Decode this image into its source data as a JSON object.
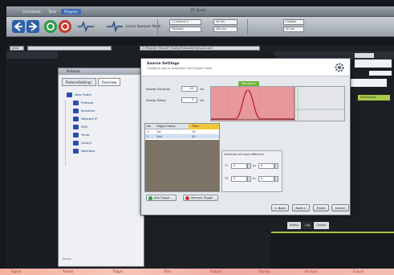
{
  "window": {
    "title": "RF Studio"
  },
  "menubar": {
    "items": [
      "Commands",
      "Tools",
      "Program"
    ]
  },
  "toolbar": {
    "mode_label": "Linear Sweeper Mode",
    "field_1": "1 Channel 1",
    "field_2": "Thermal",
    "field_3": "40 ms",
    "field_4": "200 ms",
    "field_5": "Cardiac",
    "field_6": "40 ms"
  },
  "address": {
    "left_field": "Area",
    "right_field": "C:\\Program Files\\RF Studio\\Protocols\\Protocols.xml"
  },
  "file_window": {
    "title": "Protocol",
    "tabs": [
      "ProtocolSettings",
      "Overview"
    ],
    "tree": [
      {
        "label": "New Folder",
        "level": 0
      },
      {
        "label": "Protocol",
        "level": 1
      },
      {
        "label": "Sensitive",
        "level": 1
      },
      {
        "label": "Network IP",
        "level": 1
      },
      {
        "label": "SMS",
        "level": 1
      },
      {
        "label": "Timer",
        "level": 1
      },
      {
        "label": "Library",
        "level": 1
      },
      {
        "label": "Workflow",
        "level": 1
      }
    ]
  },
  "dialog": {
    "title": "Source Settings",
    "subtitle": "Configure source acquisition and trigger mode",
    "params": [
      {
        "label": "Sweep Duration",
        "value": "40",
        "unit": "ms"
      },
      {
        "label": "Sweep Delay",
        "value": "0",
        "unit": "ms"
      }
    ],
    "plot_tag": "Waveform",
    "table": {
      "headers": [
        "No",
        "Trigger Name",
        "Time"
      ],
      "rows": [
        {
          "no": "1",
          "name": "1st",
          "time": "10"
        },
        {
          "no": "2",
          "name": "2nd",
          "time": "20"
        }
      ]
    },
    "buttons": {
      "add": "Add Trigger",
      "remove": "Remove Trigger"
    },
    "sub_panel": {
      "header": "amplitude and wave difference",
      "rows": [
        {
          "lbl_a": "T1",
          "val_a": "0",
          "lbl_b": "to",
          "val_b": "0"
        },
        {
          "lbl_a": "T2",
          "val_a": "0",
          "lbl_b": "to",
          "val_b": "0"
        }
      ]
    },
    "footer": {
      "back": "< Back",
      "next": "Next >",
      "finish": "Finish",
      "cancel": "Cancel"
    }
  },
  "right_panel": {
    "green_tab": "Parameters",
    "tabs": [
      "Status",
      "Log",
      "Output"
    ]
  },
  "bottom_note": "Ready",
  "bottom_strip": [
    "Signal",
    "Sweep",
    "Trigger",
    "Filter",
    "Output",
    "Display",
    "Analysis",
    "Export"
  ],
  "colors": {
    "accent": "#3b6fb5",
    "plot_pink": "#e88f92",
    "plot_curve": "#b61a22",
    "green": "#a9c94b"
  }
}
